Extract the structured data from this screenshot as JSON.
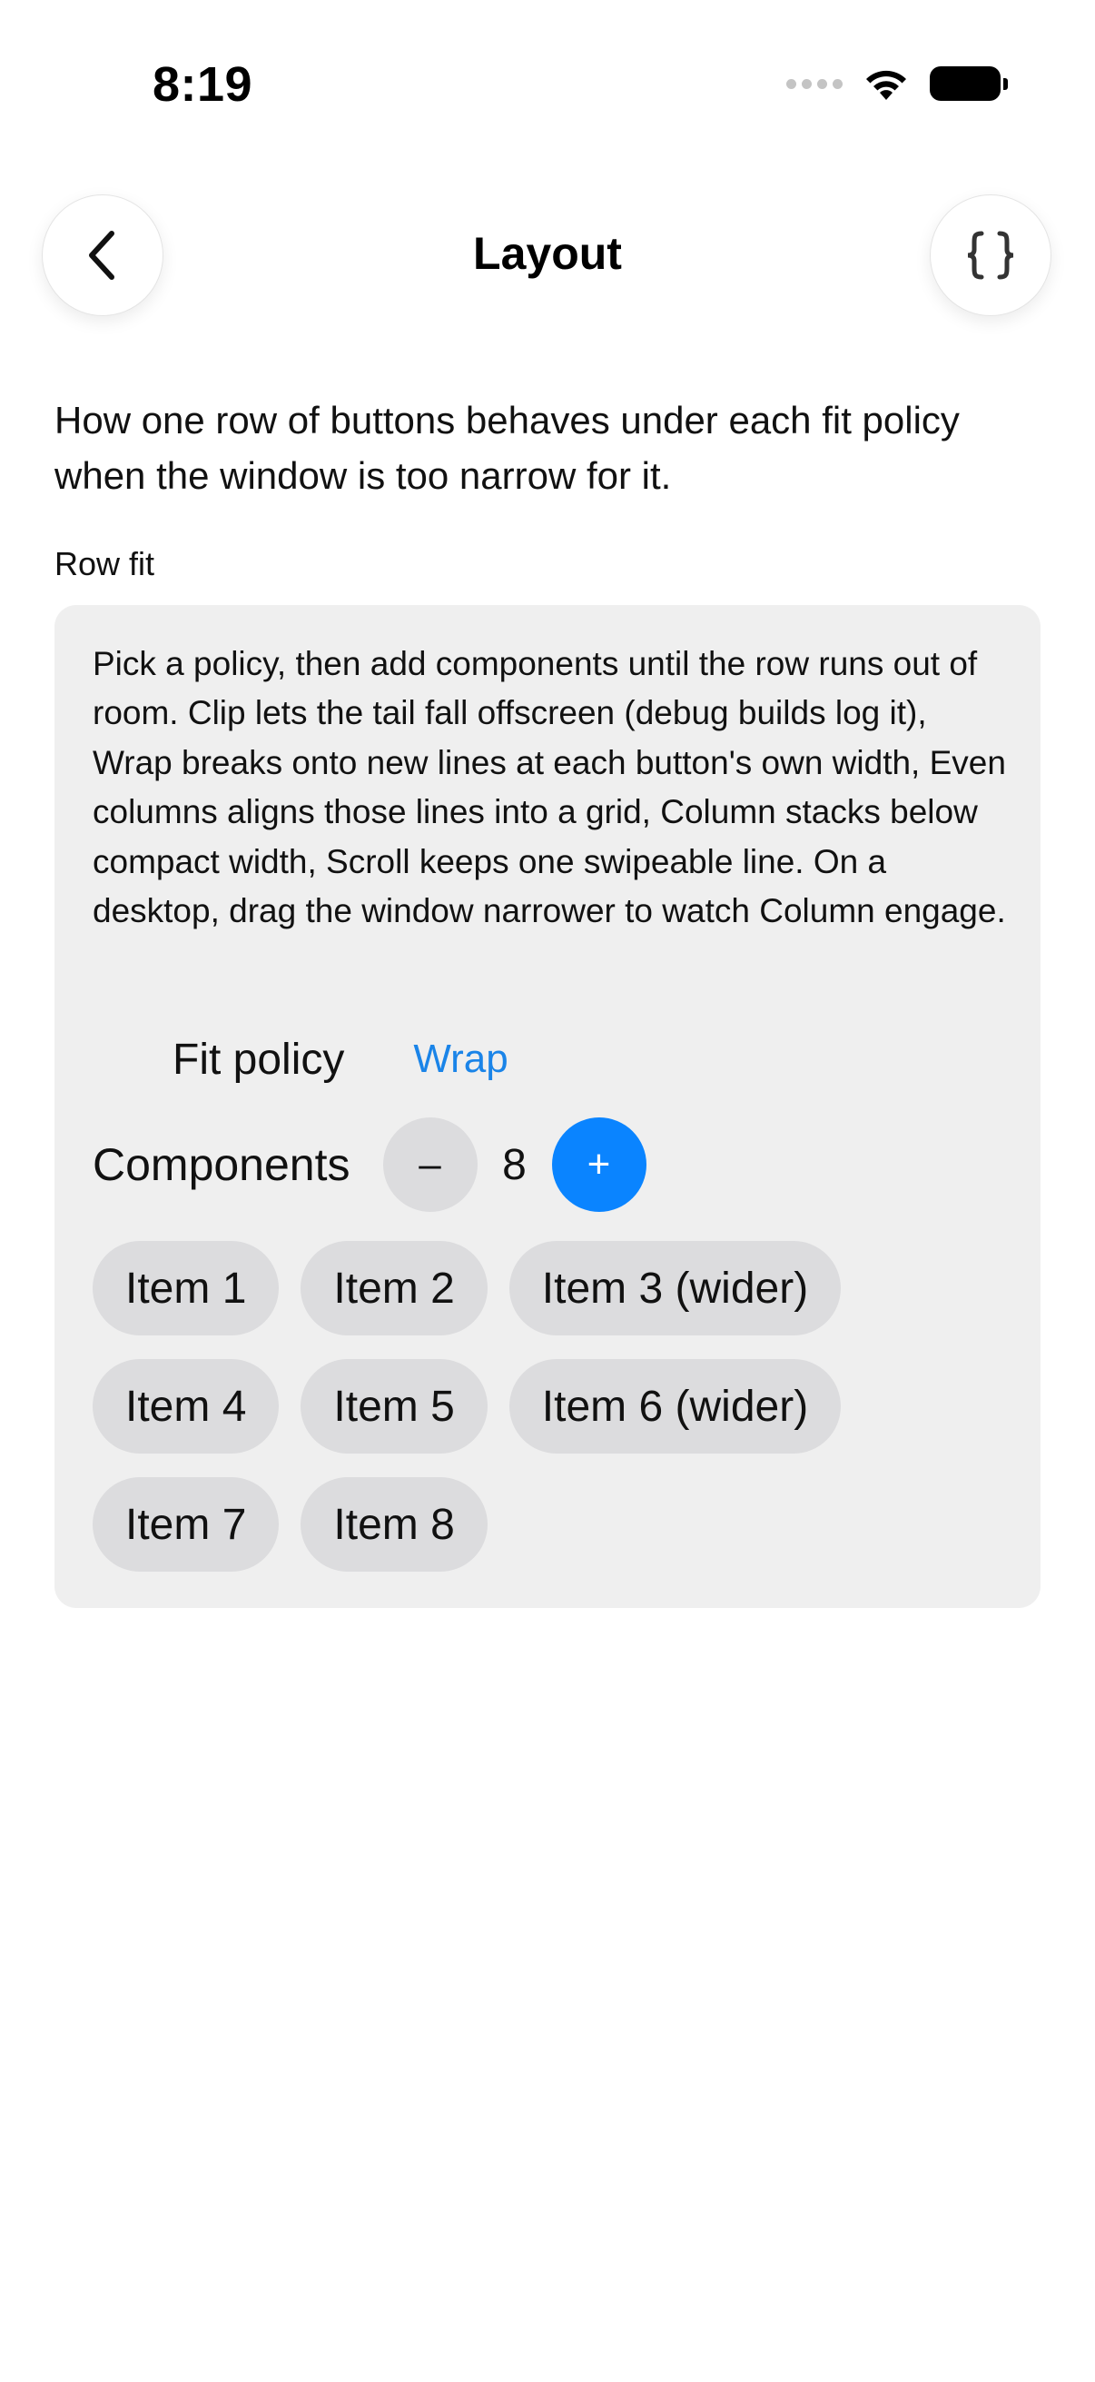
{
  "status_bar": {
    "time": "8:19"
  },
  "nav": {
    "title": "Layout",
    "back_icon": "chevron-left-icon",
    "code_icon": "braces-icon"
  },
  "intro": "How one row of buttons behaves under each fit policy when the window is too narrow for it.",
  "section_label": "Row fit",
  "card": {
    "description": "Pick a policy, then add components until the row runs out of room. Clip lets the tail fall offscreen (debug builds log it), Wrap breaks onto new lines at each button's own width, Even columns aligns those lines into a grid, Column stacks below compact width, Scroll keeps one swipeable line. On a desktop, drag the window narrower to watch Column engage.",
    "fit_policy_label": "Fit policy",
    "fit_policy_value": "Wrap",
    "components_label": "Components",
    "minus_label": "–",
    "plus_label": "+",
    "count": "8",
    "items": [
      [
        "Item 1",
        "Item 2",
        "Item 3 (wider)"
      ],
      [
        "Item 4",
        "Item 5",
        "Item 6 (wider)"
      ],
      [
        "Item 7",
        "Item 8"
      ]
    ]
  },
  "colors": {
    "accent": "#0a84ff",
    "link": "#1a84e8",
    "card_bg": "#efefef",
    "pill_bg": "#dcdcde"
  }
}
